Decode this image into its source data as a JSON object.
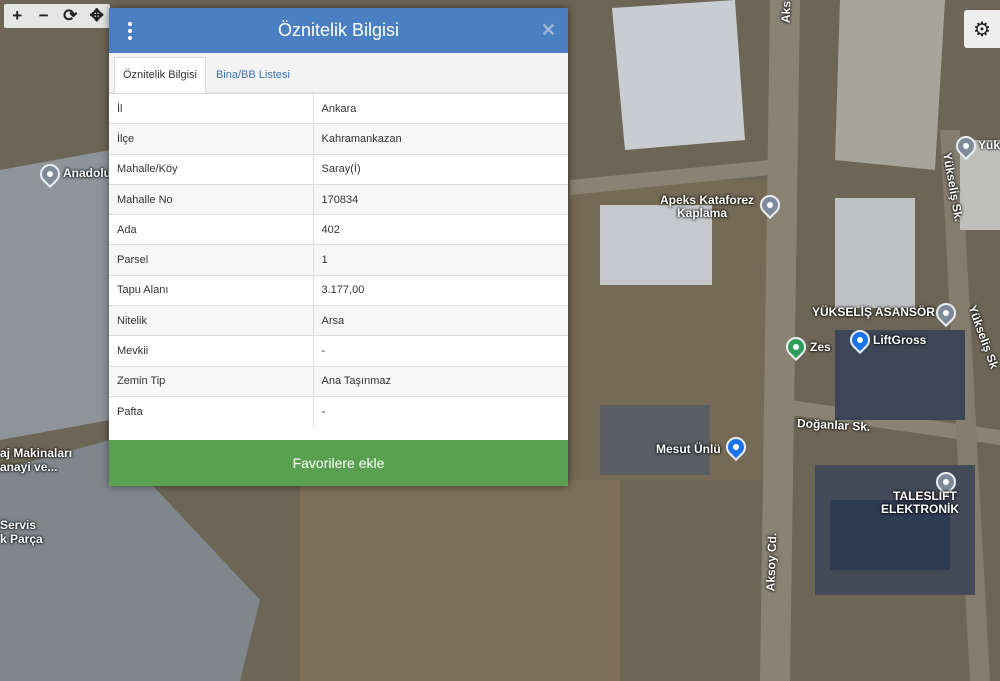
{
  "dialog": {
    "title": "Öznitelik Bilgisi",
    "close_icon": "close-icon",
    "menu_icon": "vertical-dots-icon",
    "tabs": [
      {
        "label": "Öznitelik Bilgisi",
        "active": true
      },
      {
        "label": "Bina/BB Listesi",
        "active": false
      }
    ],
    "rows": [
      {
        "key": "İl",
        "value": "Ankara"
      },
      {
        "key": "İlçe",
        "value": "Kahramankazan"
      },
      {
        "key": "Mahalle/Köy",
        "value": "Saray(İ)"
      },
      {
        "key": "Mahalle No",
        "value": "170834"
      },
      {
        "key": "Ada",
        "value": "402"
      },
      {
        "key": "Parsel",
        "value": "1"
      },
      {
        "key": "Tapu Alanı",
        "value": "3.177,00"
      },
      {
        "key": "Nitelik",
        "value": "Arsa"
      },
      {
        "key": "Mevkii",
        "value": "-"
      },
      {
        "key": "Zemin Tip",
        "value": "Ana Taşınmaz"
      },
      {
        "key": "Pafta",
        "value": "-"
      }
    ],
    "favorite_button": "Favorilere ekle",
    "colors": {
      "header": "#4a80c1",
      "button": "#59a150",
      "tab_link": "#3b73b9"
    }
  },
  "toolbar": {
    "tools": [
      {
        "name": "zoom-in-icon",
        "glyph": "+"
      },
      {
        "name": "zoom-out-icon",
        "glyph": "−"
      },
      {
        "name": "refresh-icon",
        "glyph": "⟳"
      },
      {
        "name": "move-icon",
        "glyph": "✥"
      }
    ]
  },
  "settings_icon": "gear-icon",
  "map_labels": {
    "anadolu": "Anadolu",
    "makinalari": "aj Makinaları",
    "sanayi": "anayi ve...",
    "servis": "Servis",
    "parca": "k Parça",
    "apeks1": "Apeks Kataforez",
    "apeks2": "Kaplama",
    "yukselis_asansor": "YÜKSELİŞ ASANSÖR",
    "liftgross": "LiftGross",
    "zes": "Zes",
    "doganlar": "Doğanlar Sk.",
    "mesut": "Mesut Ünlü",
    "taleslift1": "TALESLIFT",
    "taleslift2": "ELEKTRONİK",
    "aksoy_cd": "Aksoy Cd.",
    "aksoy_top": "Aks",
    "yukselis_sk1": "Yükseliş Sk.",
    "yukselis_sk2": "Yükseliş Sk",
    "yukselis_sk_top": "Yükseliş"
  }
}
